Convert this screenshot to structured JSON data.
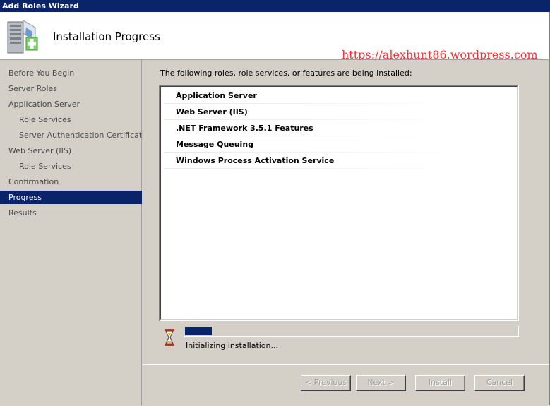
{
  "window": {
    "title": "Add Roles Wizard"
  },
  "header": {
    "title": "Installation Progress",
    "icon": "server-add-icon"
  },
  "watermark": "https://alexhunt86.wordpress.com",
  "sidebar": {
    "items": [
      {
        "label": "Before You Begin"
      },
      {
        "label": "Server Roles"
      },
      {
        "label": "Application Server"
      },
      {
        "label": "Role Services"
      },
      {
        "label": "Server Authentication Certificate"
      },
      {
        "label": "Web Server (IIS)"
      },
      {
        "label": "Role Services"
      },
      {
        "label": "Confirmation"
      },
      {
        "label": "Progress"
      },
      {
        "label": "Results"
      }
    ],
    "active_index": 8
  },
  "main": {
    "intro": "The following roles, role services, or features are being installed:",
    "roles": [
      "Application Server",
      "Web Server (IIS)",
      ".NET Framework 3.5.1 Features",
      "Message Queuing",
      "Windows Process Activation Service"
    ],
    "progress": {
      "fraction": 0.08,
      "status": "Initializing installation..."
    }
  },
  "footer": {
    "previous_label": "< Previous",
    "next_label": "Next >",
    "install_label": "Install",
    "cancel_label": "Cancel"
  },
  "colors": {
    "selection": "#0a246a",
    "watermark": "#ff2d2d",
    "face": "#d4d0c8"
  }
}
